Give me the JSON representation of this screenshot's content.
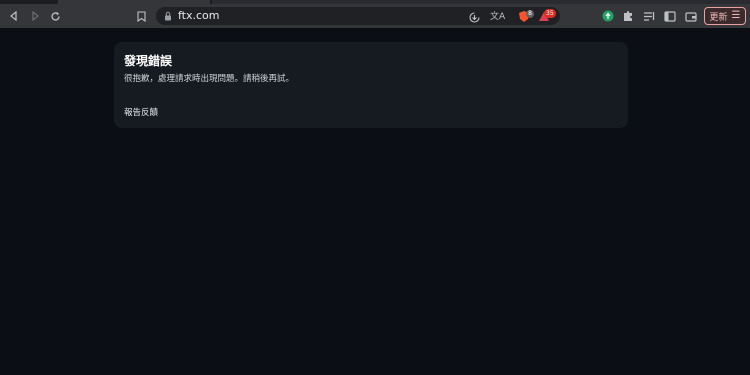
{
  "browser": {
    "url": "ftx.com",
    "icons": {
      "back": "back-arrow-icon",
      "forward": "forward-arrow-icon",
      "reload": "reload-icon",
      "bookmark": "bookmark-icon",
      "lock": "lock-icon",
      "install": "install-app-icon",
      "translate": "translate-icon",
      "brave_shield": "brave-shield-icon",
      "rewards": "brave-rewards-icon",
      "extension_green": "extension-icon",
      "extensions": "puzzle-icon",
      "reading_list": "reading-list-icon",
      "sidebar": "sidebar-icon",
      "wallet": "wallet-icon",
      "menu": "hamburger-menu-icon"
    },
    "shield_badge": "8",
    "rewards_badge": "35",
    "update_label": "更新",
    "update_menu_glyph": "☰"
  },
  "error": {
    "title": "發現錯誤",
    "message": "很抱歉，處理請求時出現問題。請稍後再試。",
    "report_link": "報告反饋"
  },
  "colors": {
    "page_bg": "#0b0e14",
    "card_bg": "#161b22",
    "toolbar_bg": "#35363a",
    "update_border": "#e8a1a1",
    "badge_red": "#d93025"
  }
}
